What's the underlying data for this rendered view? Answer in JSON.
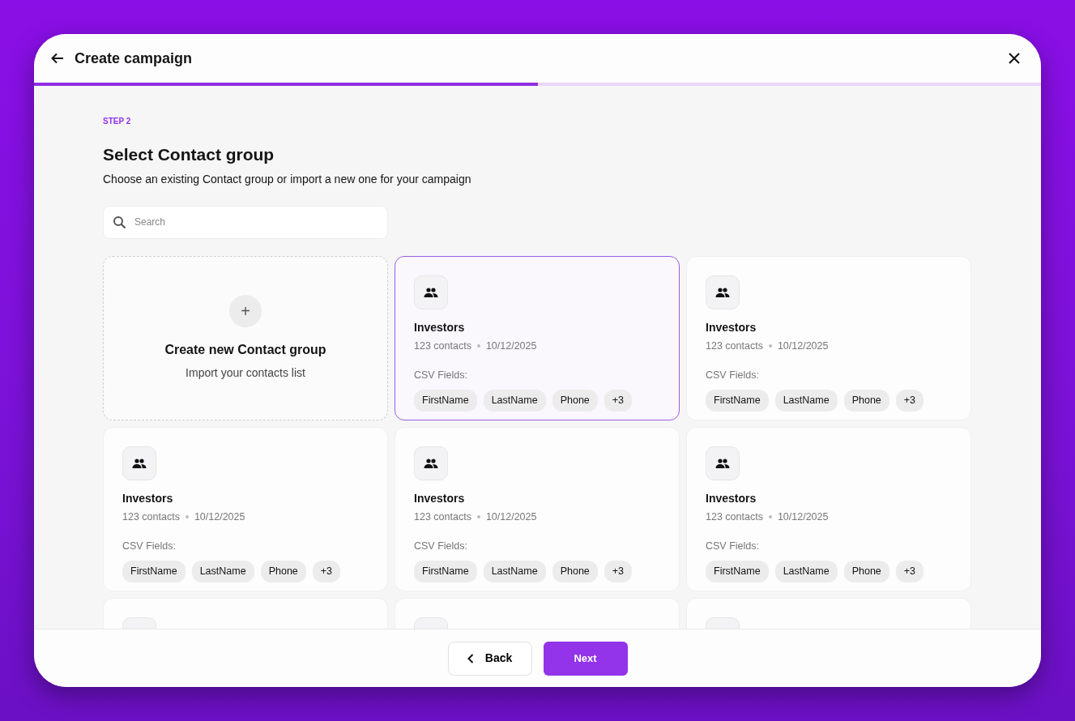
{
  "header": {
    "title": "Create campaign",
    "progress": {
      "level": 0.5
    }
  },
  "step": {
    "label": "STEP 2",
    "title": "Select Contact group",
    "description": "Choose an existing Contact group or import a new one for your campaign"
  },
  "search": {
    "placeholder": "Search"
  },
  "cards": [
    {
      "kind": "create",
      "icon": "+",
      "title": "Create new Contact group",
      "subtitle": "Import your contacts list"
    },
    {
      "kind": "group",
      "selected": true,
      "name": "Investors",
      "contacts": "123 contacts",
      "date": "10/12/2025",
      "fields_label": "CSV Fields:",
      "fields": [
        "FirstName",
        "LastName",
        "Phone",
        "+3"
      ]
    },
    {
      "kind": "group",
      "selected": false,
      "name": "Investors",
      "contacts": "123 contacts",
      "date": "10/12/2025",
      "fields_label": "CSV Fields:",
      "fields": [
        "FirstName",
        "LastName",
        "Phone",
        "+3"
      ]
    },
    {
      "kind": "group",
      "selected": false,
      "name": "Investors",
      "contacts": "123 contacts",
      "date": "10/12/2025",
      "fields_label": "CSV Fields:",
      "fields": [
        "FirstName",
        "LastName",
        "Phone",
        "+3"
      ]
    },
    {
      "kind": "group",
      "selected": false,
      "name": "Investors",
      "contacts": "123 contacts",
      "date": "10/12/2025",
      "fields_label": "CSV Fields:",
      "fields": [
        "FirstName",
        "LastName",
        "Phone",
        "+3"
      ]
    },
    {
      "kind": "group",
      "selected": false,
      "name": "Investors",
      "contacts": "123 contacts",
      "date": "10/12/2025",
      "fields_label": "CSV Fields:",
      "fields": [
        "FirstName",
        "LastName",
        "Phone",
        "+3"
      ]
    },
    {
      "kind": "group",
      "selected": false
    },
    {
      "kind": "group",
      "selected": false
    },
    {
      "kind": "group",
      "selected": false
    }
  ],
  "footer": {
    "back": "Back",
    "next": "Next"
  }
}
